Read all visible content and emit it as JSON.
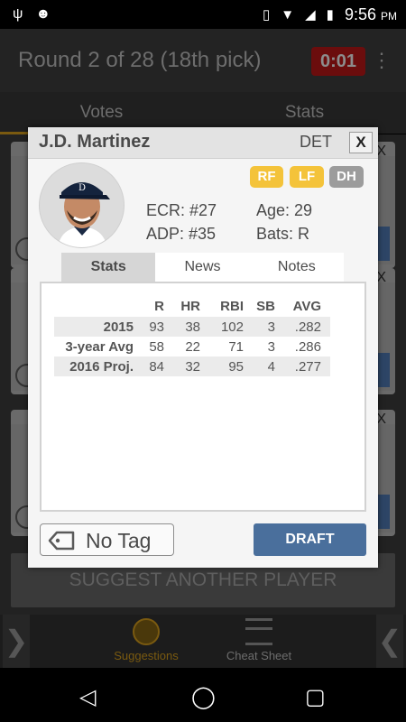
{
  "status_bar": {
    "time": "9:56",
    "ampm": "PM"
  },
  "app_bar": {
    "title": "Round 2 of 28 (18th pick)",
    "timer": "0:01"
  },
  "tabs": [
    {
      "label": "Votes"
    },
    {
      "label": "Stats"
    }
  ],
  "suggest_button": "SUGGEST ANOTHER PLAYER",
  "bottom_nav": {
    "items": [
      {
        "label": "Suggestions"
      },
      {
        "label": "Cheat Sheet"
      }
    ]
  },
  "modal": {
    "player_name": "J.D. Martinez",
    "team": "DET",
    "close_label": "X",
    "positions": [
      {
        "label": "RF"
      },
      {
        "label": "LF"
      },
      {
        "label": "DH"
      }
    ],
    "ecr": "ECR: #27",
    "adp": "ADP: #35",
    "age": "Age: 29",
    "bats": "Bats: R",
    "subtabs": [
      {
        "label": "Stats"
      },
      {
        "label": "News"
      },
      {
        "label": "Notes"
      }
    ],
    "stats": {
      "headers": [
        "",
        "R",
        "HR",
        "RBI",
        "SB",
        "AVG"
      ],
      "rows": [
        {
          "label": "2015",
          "values": [
            "93",
            "38",
            "102",
            "3",
            ".282"
          ]
        },
        {
          "label": "3-year Avg",
          "values": [
            "58",
            "22",
            "71",
            "3",
            ".286"
          ]
        },
        {
          "label": "2016 Proj.",
          "values": [
            "84",
            "32",
            "95",
            "4",
            ".277"
          ]
        }
      ]
    },
    "tag_label": "No Tag",
    "draft_label": "DRAFT"
  },
  "colors": {
    "accent": "#f4c33a",
    "draft_button": "#4a6f9c",
    "timer_bg": "#6b0d0d"
  }
}
